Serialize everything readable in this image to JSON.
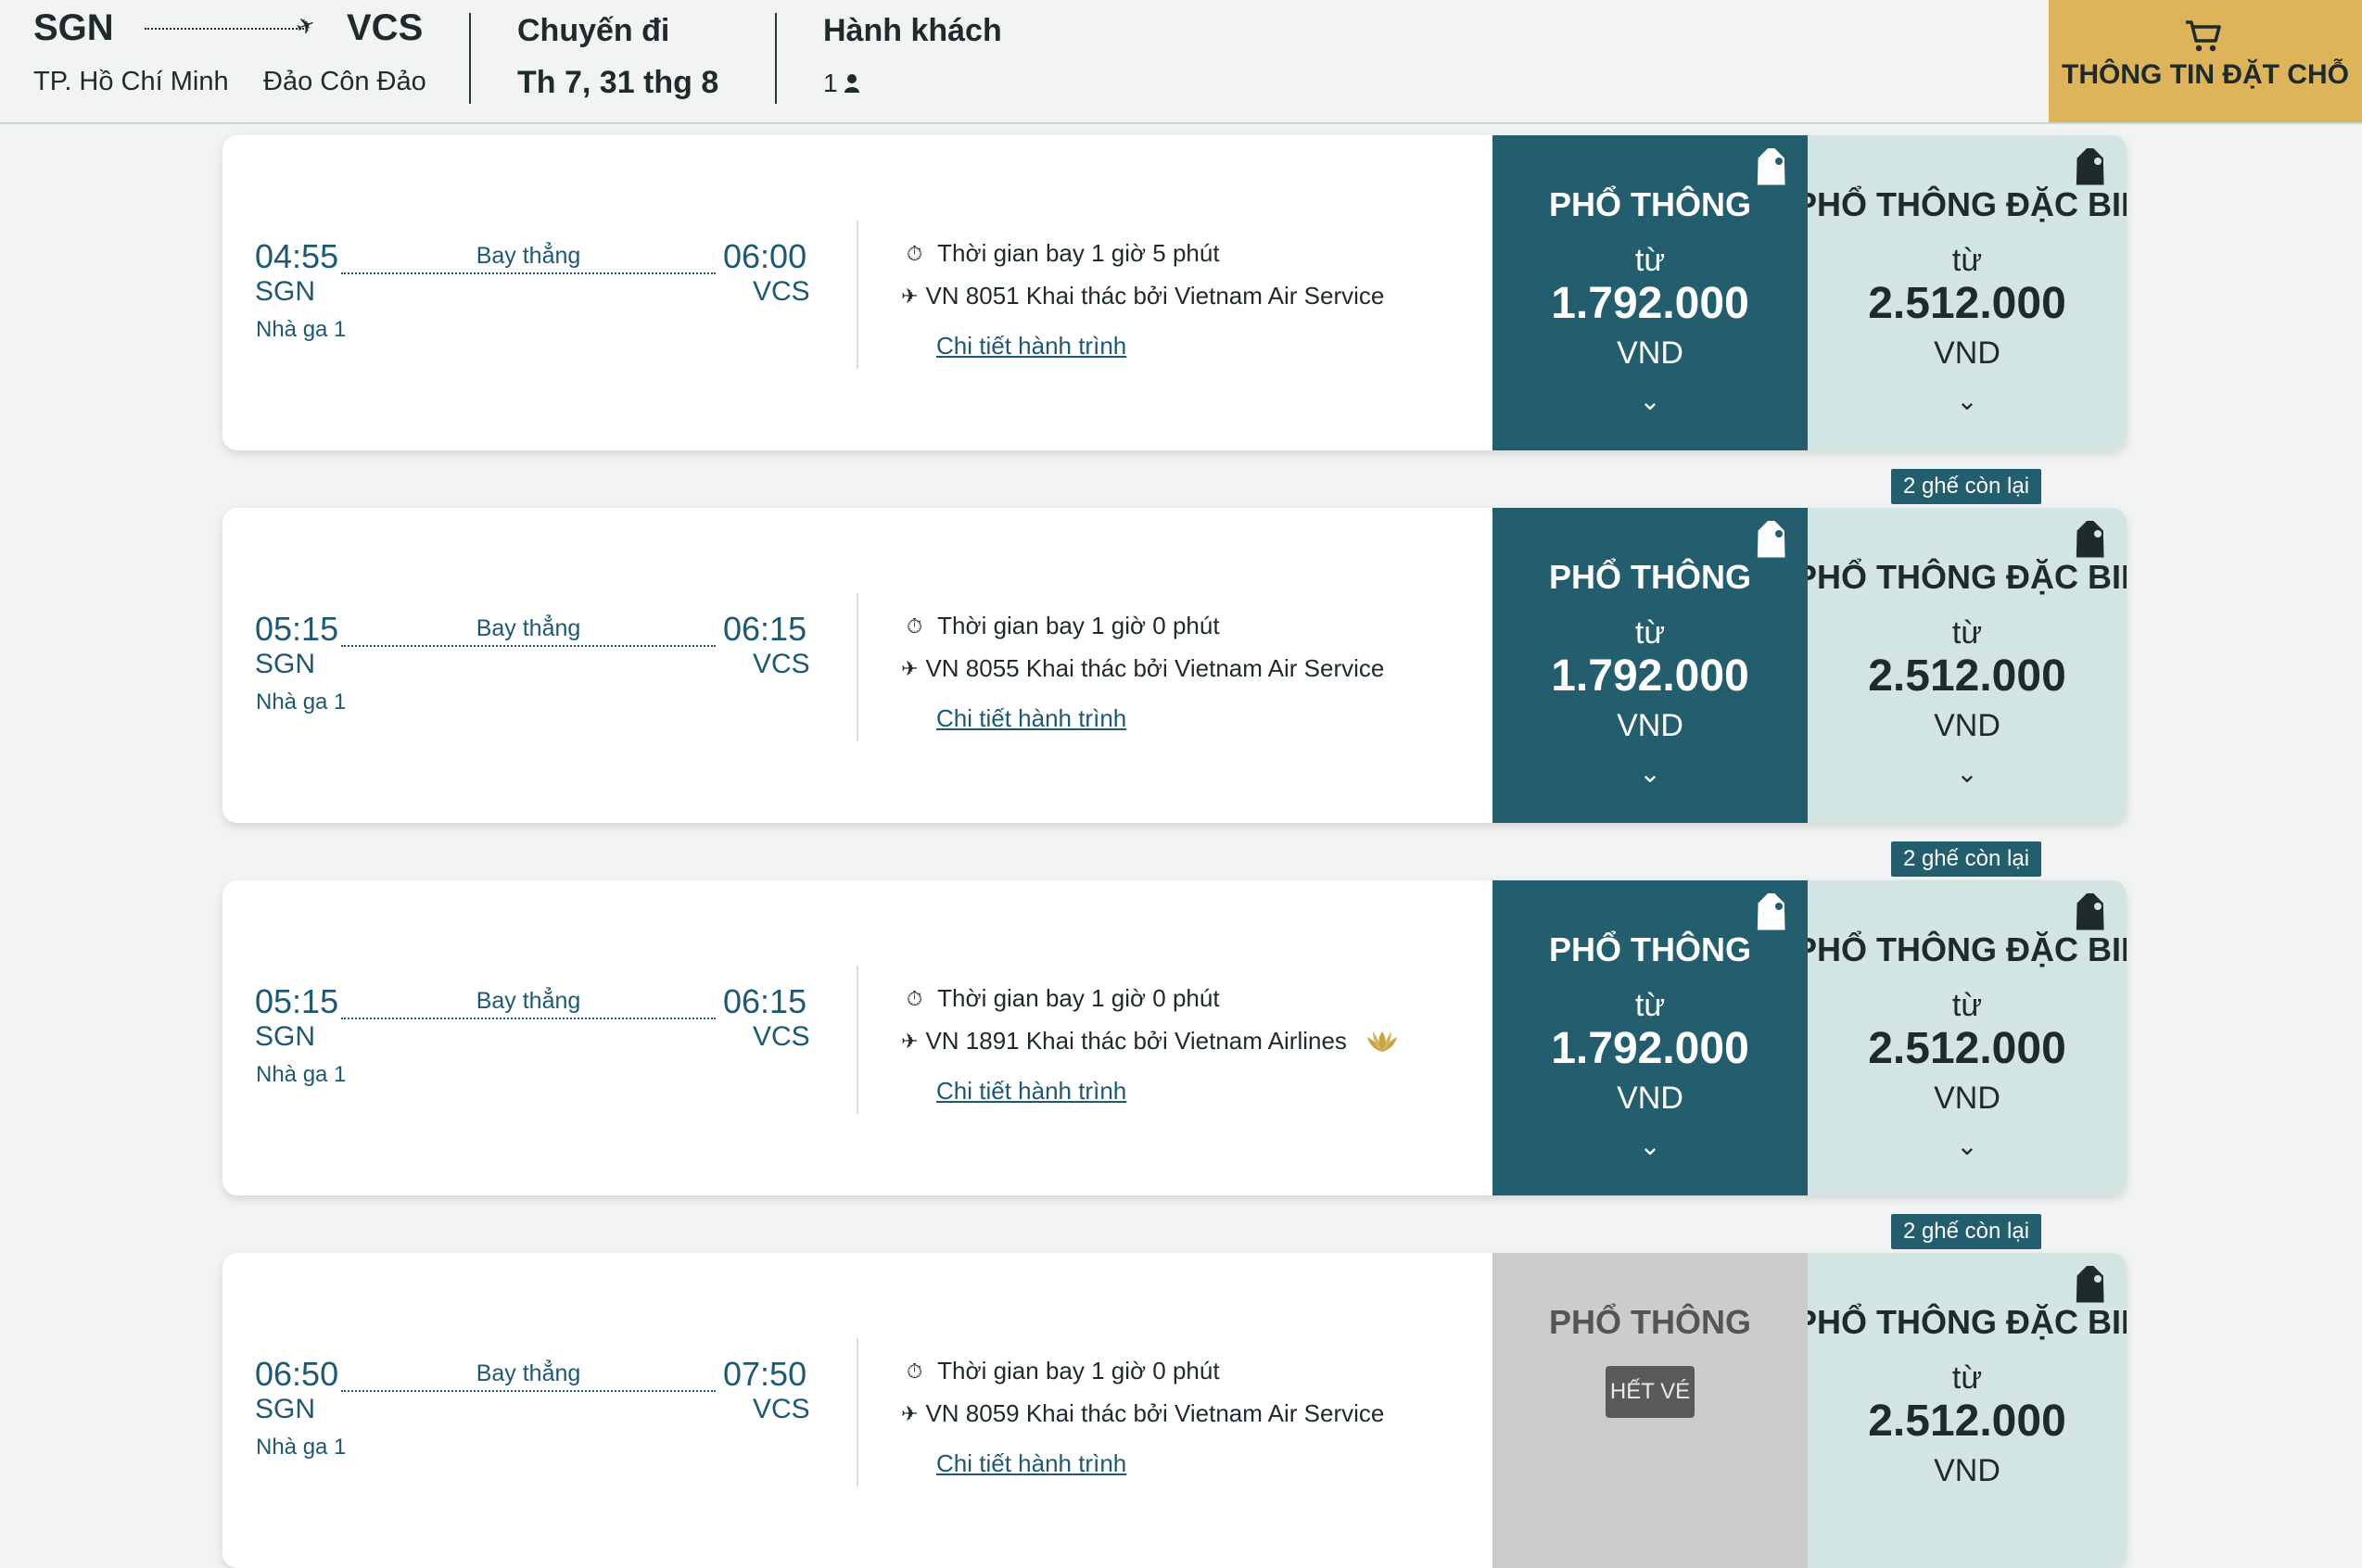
{
  "header": {
    "origin_code": "SGN",
    "destination_code": "VCS",
    "origin_city": "TP. Hồ Chí Minh",
    "destination_city": "Đảo Côn Đảo",
    "trip_label": "Chuyến đi",
    "trip_date": "Th 7, 31 thg 8",
    "passengers_label": "Hành khách",
    "passengers_count": "1",
    "cart_label": "THÔNG TIN ĐẶT CHỖ"
  },
  "flights": [
    {
      "depart_time": "04:55",
      "arrive_time": "06:00",
      "origin": "SGN",
      "destination": "VCS",
      "terminal": "Nhà ga 1",
      "stops": "Bay thẳng",
      "duration": "Thời gian bay 1 giờ 5 phút",
      "flight_info": "VN 8051 Khai thác bởi Vietnam Air Service",
      "details_link": "Chi tiết hành trình",
      "economy": {
        "title": "PHỔ THÔNG",
        "from": "từ",
        "price": "1.792.000",
        "currency": "VND",
        "sold_out": ""
      },
      "premium": {
        "title": "PHỔ THÔNG ĐẶC BIỆT",
        "from": "từ",
        "price": "2.512.000",
        "currency": "VND"
      }
    },
    {
      "depart_time": "05:15",
      "arrive_time": "06:15",
      "origin": "SGN",
      "destination": "VCS",
      "terminal": "Nhà ga 1",
      "stops": "Bay thẳng",
      "duration": "Thời gian bay 1 giờ 0 phút",
      "flight_info": "VN 8055 Khai thác bởi Vietnam Air Service",
      "details_link": "Chi tiết hành trình",
      "seats_left": "2 ghế còn lại",
      "economy": {
        "title": "PHỔ THÔNG",
        "from": "từ",
        "price": "1.792.000",
        "currency": "VND",
        "sold_out": ""
      },
      "premium": {
        "title": "PHỔ THÔNG ĐẶC BIỆT",
        "from": "từ",
        "price": "2.512.000",
        "currency": "VND"
      }
    },
    {
      "depart_time": "05:15",
      "arrive_time": "06:15",
      "origin": "SGN",
      "destination": "VCS",
      "terminal": "Nhà ga 1",
      "stops": "Bay thẳng",
      "duration": "Thời gian bay 1 giờ 0 phút",
      "flight_info": "VN 1891 Khai thác bởi Vietnam Airlines",
      "details_link": "Chi tiết hành trình",
      "seats_left": "2 ghế còn lại",
      "economy": {
        "title": "PHỔ THÔNG",
        "from": "từ",
        "price": "1.792.000",
        "currency": "VND",
        "sold_out": ""
      },
      "premium": {
        "title": "PHỔ THÔNG ĐẶC BIỆT",
        "from": "từ",
        "price": "2.512.000",
        "currency": "VND"
      }
    },
    {
      "depart_time": "06:50",
      "arrive_time": "07:50",
      "origin": "SGN",
      "destination": "VCS",
      "terminal": "Nhà ga 1",
      "stops": "Bay thẳng",
      "duration": "Thời gian bay 1 giờ 0 phút",
      "flight_info": "VN 8059 Khai thác bởi Vietnam Air Service",
      "details_link": "Chi tiết hành trình",
      "seats_left": "2 ghế còn lại",
      "economy": {
        "title": "PHỔ THÔNG",
        "from": "",
        "price": "",
        "currency": "",
        "sold_out": "HẾT VÉ"
      },
      "premium": {
        "title": "PHỔ THÔNG ĐẶC BIỆT",
        "from": "từ",
        "price": "2.512.000",
        "currency": "VND"
      }
    }
  ],
  "colors": {
    "brand_teal": "#235e6f",
    "premium_bg": "#d3e5e3",
    "cart_gold": "#ddb45a",
    "link_blue": "#1e5973",
    "sold_out_grey": "#cccccc"
  },
  "icons": {
    "route": "plane-icon",
    "passenger": "person-icon",
    "cart": "cart-icon",
    "duration": "stopwatch-icon",
    "flight": "plane-icon",
    "airline": "lotus-logo-icon",
    "fare_tag": "tag-icon",
    "expand": "chevron-down-icon"
  }
}
